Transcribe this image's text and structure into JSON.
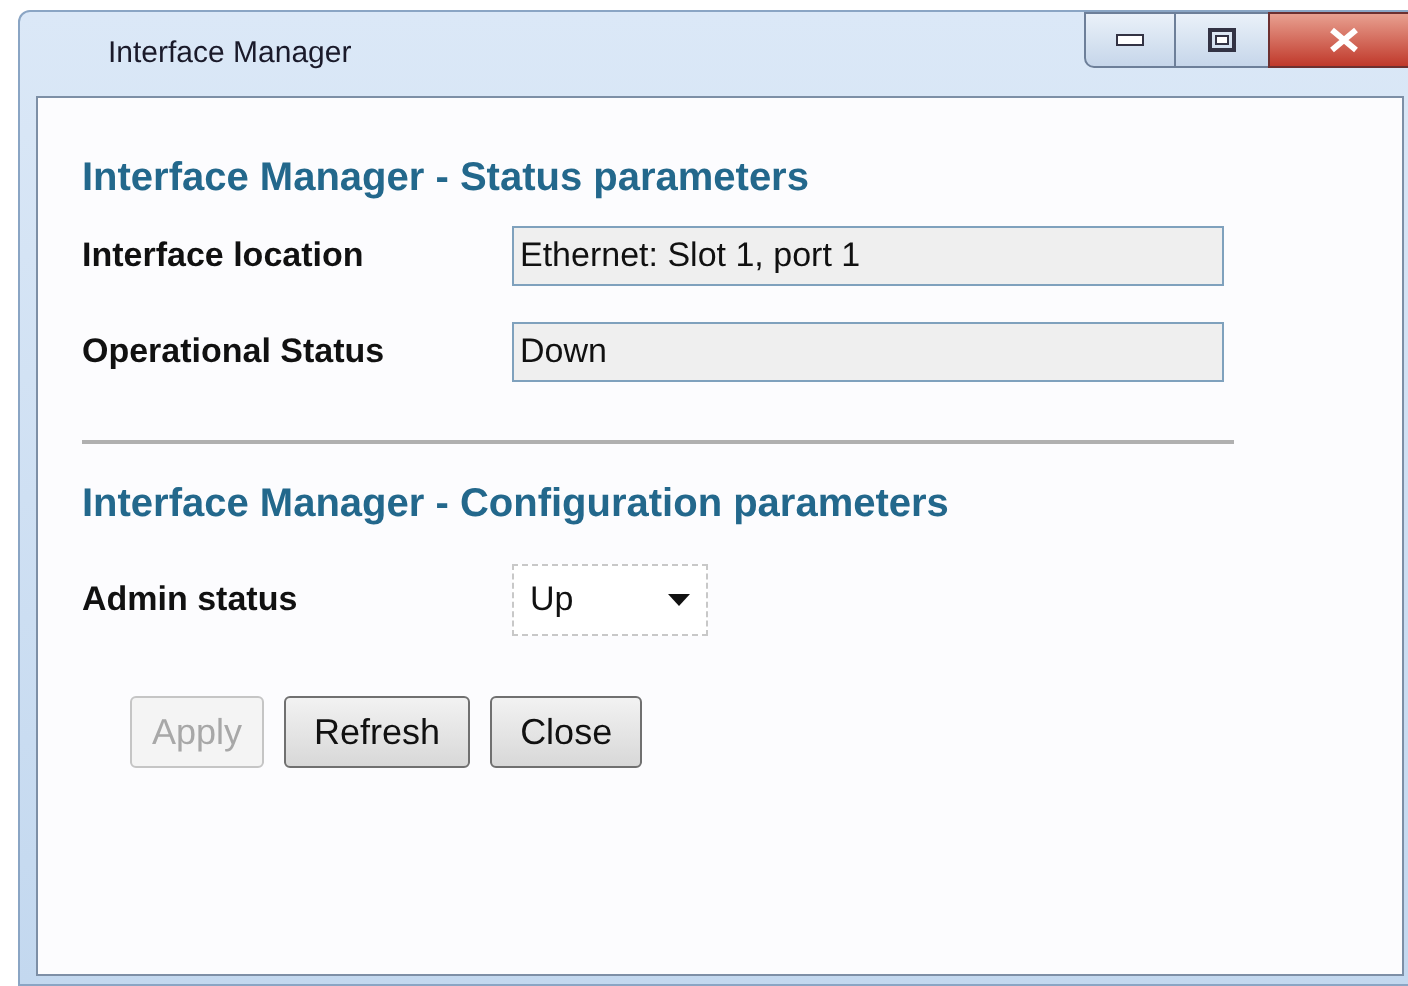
{
  "window": {
    "title": "Interface Manager"
  },
  "status_section": {
    "heading": "Interface Manager - Status parameters",
    "fields": [
      {
        "label": "Interface location",
        "value": "Ethernet: Slot 1, port 1"
      },
      {
        "label": "Operational Status",
        "value": "Down"
      }
    ]
  },
  "config_section": {
    "heading": "Interface Manager - Configuration parameters",
    "admin_status": {
      "label": "Admin status",
      "value": "Up"
    }
  },
  "buttons": [
    {
      "label": "Apply",
      "disabled": true
    },
    {
      "label": "Refresh",
      "disabled": false
    },
    {
      "label": "Close",
      "disabled": false
    }
  ]
}
